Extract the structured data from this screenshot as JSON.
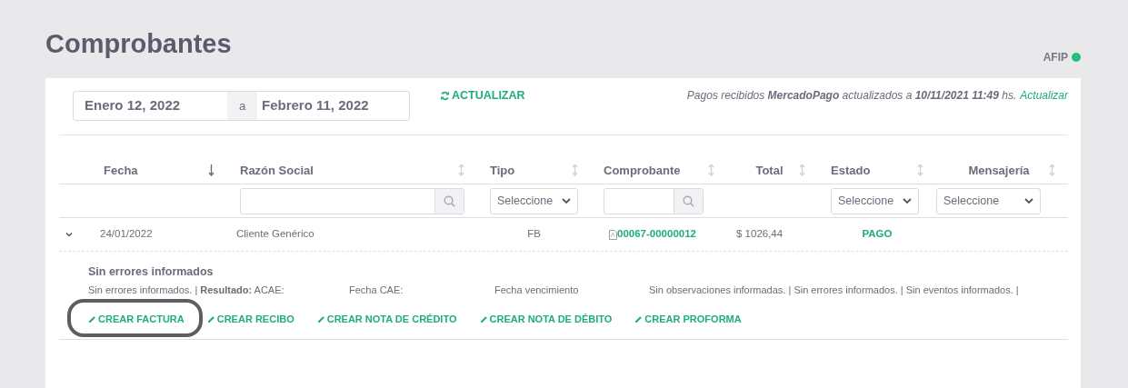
{
  "title": "Comprobantes",
  "afip": {
    "label": "AFIP",
    "color": "#22c07a"
  },
  "date_range": {
    "from": "Enero 12, 2022",
    "separator": "a",
    "to": "Febrero 11, 2022"
  },
  "refresh_button": "ACTUALIZAR",
  "sync_note": {
    "text": "Pagos recibidos **MercadoPago** actualizados a **10/11/2021 11:49** hs.",
    "link": "Actualizar"
  },
  "table": {
    "columns": [
      {
        "label": "Fecha",
        "sorted": true
      },
      {
        "label": "Razón Social",
        "sorted": false,
        "kind": "search"
      },
      {
        "label": "Tipo",
        "sorted": false,
        "kind": "select",
        "placeholder": "Seleccione"
      },
      {
        "label": "Comprobante",
        "sorted": false,
        "kind": "search"
      },
      {
        "label": "Total",
        "sorted": false
      },
      {
        "label": "Estado",
        "sorted": false,
        "kind": "select",
        "placeholder": "Seleccione"
      },
      {
        "label": "Mensajería",
        "sorted": false,
        "kind": "select",
        "placeholder": "Seleccione"
      }
    ],
    "rows": [
      {
        "expanded": true,
        "fecha": "24/01/2022",
        "razon_social": "Cliente Genérico",
        "tipo": "FB",
        "comprobante": "00067-00000012",
        "total": "$ 1026,44",
        "estado": "PAGO",
        "detail": {
          "heading": "Sin errores informados",
          "info": [
            "Sin errores informados. | **Resultado:** ACAE:",
            "Fecha CAE:",
            "Fecha vencimiento",
            "Sin observaciones informadas. | Sin errores informados. | Sin eventos informados. |"
          ],
          "actions": [
            {
              "label": "CREAR FACTURA",
              "highlighted": true
            },
            {
              "label": "CREAR RECIBO",
              "highlighted": false
            },
            {
              "label": "CREAR NOTA DE CRÉDITO",
              "highlighted": false
            },
            {
              "label": "CREAR NOTA DE DÉBITO",
              "highlighted": false
            },
            {
              "label": "CREAR PROFORMA",
              "highlighted": false
            }
          ]
        }
      }
    ]
  }
}
